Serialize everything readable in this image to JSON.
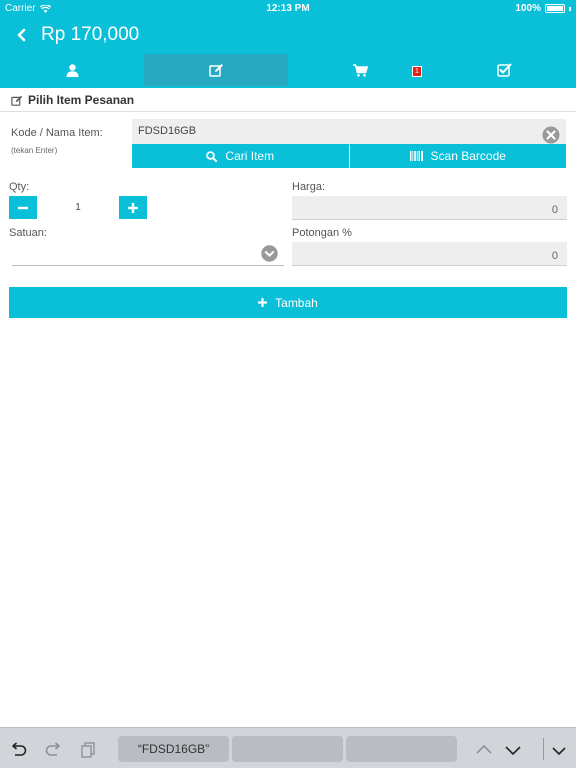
{
  "status": {
    "carrier": "Carrier",
    "time": "12:13 PM",
    "battery": "100%"
  },
  "header": {
    "title": "Rp 170,000"
  },
  "tabs": [
    {
      "icon": "user-icon"
    },
    {
      "icon": "edit-icon",
      "active": true
    },
    {
      "icon": "cart-icon",
      "badge": "1"
    },
    {
      "icon": "checklist-icon"
    }
  ],
  "section": {
    "title": "Pilih Item Pesanan"
  },
  "form": {
    "item_label": "Kode / Nama Item:",
    "item_hint": "(tekan Enter)",
    "item_value": "FDSD16GB",
    "search_label": "Cari Item",
    "scan_label": "Scan Barcode",
    "qty_label": "Qty:",
    "qty_value": "1",
    "harga_label": "Harga:",
    "harga_value": "0",
    "satuan_label": "Satuan:",
    "satuan_value": "",
    "potongan_label": "Potongan %",
    "potongan_value": "0",
    "add_label": "Tambah"
  },
  "keyboard": {
    "suggestions": [
      "“FDSD16GB”",
      "",
      ""
    ]
  },
  "colors": {
    "accent": "#0abfd8",
    "tab_active": "#27a9c2",
    "badge": "#e0201d"
  }
}
